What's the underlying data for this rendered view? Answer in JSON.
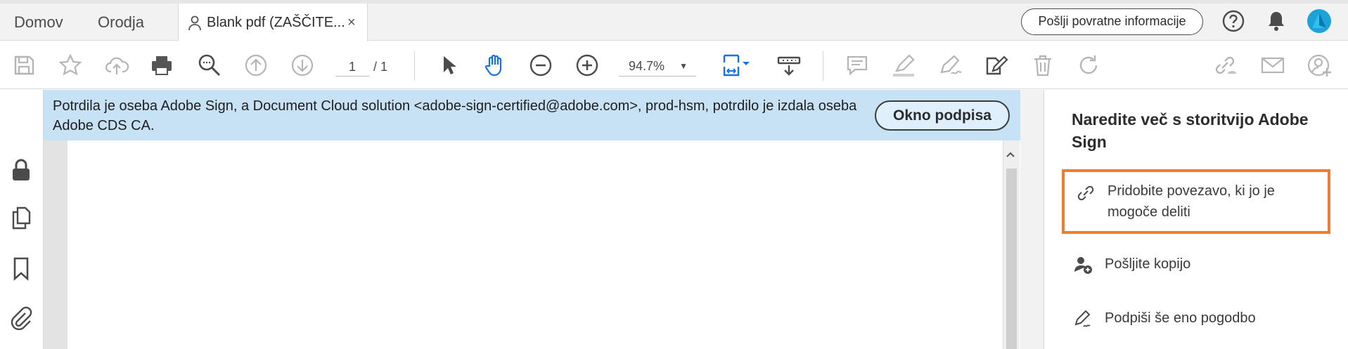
{
  "tabs": {
    "home_label": "Domov",
    "tools_label": "Orodja",
    "document_tab_title": "Blank pdf (ZAŠČITE...",
    "close_glyph": "×"
  },
  "header": {
    "feedback_label": "Pošlji povratne informacije",
    "icons": [
      "help-icon",
      "notifications-bell-icon",
      "account-avatar-icon"
    ]
  },
  "toolbar": {
    "current_page": "1",
    "page_total": "/  1",
    "zoom_value": "94.7%",
    "zoom_caret": "▼",
    "icons": [
      "save-icon",
      "bookmark-star-icon",
      "cloud-upload-icon",
      "print-icon",
      "find-zoom-icon",
      "prev-page-icon",
      "next-page-icon",
      "select-cursor-icon",
      "hand-tool-icon",
      "zoom-out-icon",
      "zoom-in-icon",
      "fit-page-icon",
      "scroll-mode-icon",
      "comment-icon",
      "highlight-icon",
      "draw-icon",
      "edit-icon",
      "delete-icon",
      "rotate-icon",
      "share-link-icon",
      "email-icon",
      "add-user-icon"
    ]
  },
  "banner": {
    "message": "Potrdila je oseba Adobe Sign, a Document Cloud solution <adobe-sign-certified@adobe.com>, prod-hsm, potrdilo je izdala oseba Adobe CDS CA.",
    "signature_panel_button": "Okno podpisa"
  },
  "left_rail": {
    "icons": [
      "lock-icon",
      "pages-icon",
      "bookmark-icon",
      "attachment-icon"
    ]
  },
  "right_panel": {
    "title": "Naredite več s storitvijo Adobe Sign",
    "items": [
      {
        "label": "Pridobite povezavo, ki jo je mogoče deliti",
        "icon": "link-icon"
      },
      {
        "label": "Pošljite kopijo",
        "icon": "send-copy-icon"
      },
      {
        "label": "Podpiši še eno pogodbo",
        "icon": "sign-pen-icon"
      }
    ]
  },
  "colors": {
    "banner_bg": "#c7e1f5",
    "highlight_border": "#ed7d31",
    "accent_blue": "#1473e6"
  }
}
